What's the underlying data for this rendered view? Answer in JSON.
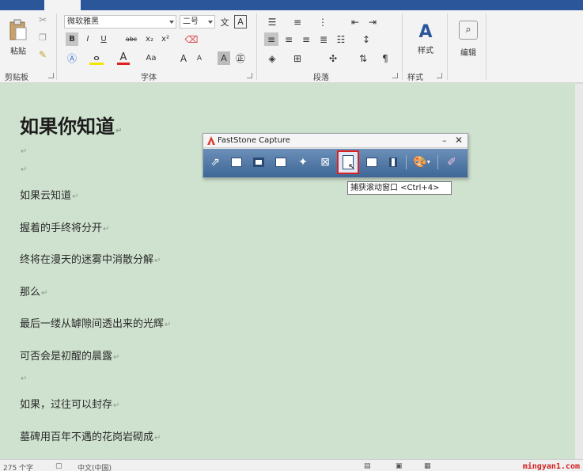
{
  "ribbon": {
    "paste_label": "粘贴",
    "clipboard_label": "剪贴板",
    "font_group_label": "字体",
    "paragraph_group_label": "段落",
    "styles_group_label": "样式",
    "styles_label": "样式",
    "edit_label": "编辑",
    "font_name": "微软雅黑",
    "font_size": "二号",
    "bold": "B",
    "italic": "I",
    "underline": "U",
    "strike": "abc",
    "subscript": "x₂",
    "superscript": "x²",
    "grow_font": "A",
    "shrink_font": "A",
    "change_case": "Aa",
    "text_highlight": "A"
  },
  "document": {
    "title": "如果你知道",
    "lines": [
      "如果云知道",
      "握着的手终将分开",
      "终将在漫天的迷雾中消散分解",
      "那么",
      "最后一缕从罅隙间透出来的光辉",
      "可否会是初醒的晨露",
      "如果，过往可以封存",
      "墓碑用百年不遇的花岗岩砌成"
    ],
    "para_mark": "↵"
  },
  "faststone": {
    "title": "FastStone Capture",
    "minimize": "–",
    "close": "✕",
    "tooltip": "捕获滚动窗口  <Ctrl+4>"
  },
  "status": {
    "word_count": "275 个字",
    "language": "中文(中国)",
    "watermark": "mingyan1.com"
  },
  "colors": {
    "tab_blue": "#2b579a",
    "doc_bg": "#cfe2cf",
    "highlight_red": "#e02020"
  }
}
